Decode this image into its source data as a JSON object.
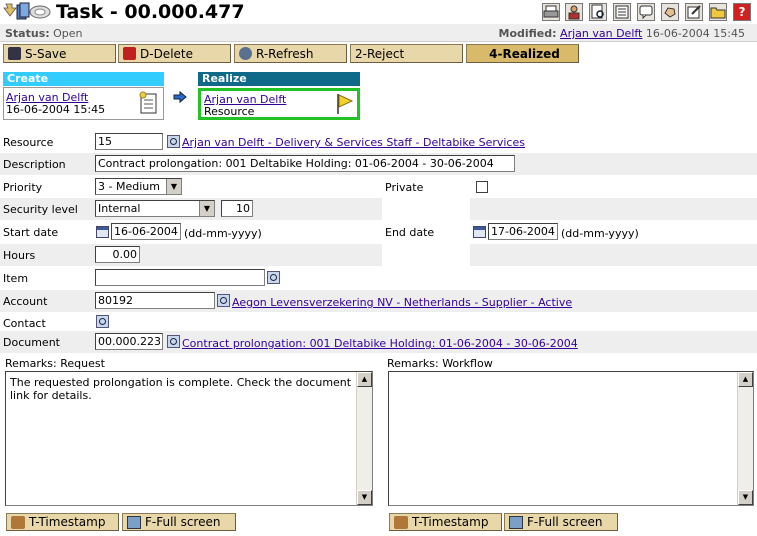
{
  "header": {
    "title": "Task - 00.000.477",
    "status_label": "Status:",
    "status_value": "Open",
    "modified_label": "Modified:",
    "modified_by": "Arjan van Delft",
    "modified_date": "16-06-2004 15:45",
    "help_label": "?"
  },
  "toolbar": {
    "save": "S-Save",
    "delete": "D-Delete",
    "refresh": "R-Refresh",
    "reject": "2-Reject",
    "realized": "4-Realized"
  },
  "workflow": {
    "create_title": "Create",
    "create_user": "Arjan van Delft",
    "create_date": "16-06-2004 15:45",
    "realize_title": "Realize",
    "realize_user": "Arjan van Delft",
    "realize_role": "Resource"
  },
  "form": {
    "resource": {
      "label": "Resource",
      "value": "15",
      "link": "Arjan van Delft - Delivery & Services Staff - Deltabike Services"
    },
    "description": {
      "label": "Description",
      "value": "Contract prolongation: 001 Deltabike Holding: 01-06-2004 - 30-06-2004"
    },
    "priority": {
      "label": "Priority",
      "value": "3 - Medium"
    },
    "private": {
      "label": "Private",
      "checked": false
    },
    "security": {
      "label": "Security level",
      "value": "Internal",
      "level": "10"
    },
    "start_date": {
      "label": "Start date",
      "value": "16-06-2004",
      "hint": "(dd-mm-yyyy)"
    },
    "end_date": {
      "label": "End date",
      "value": "17-06-2004",
      "hint": "(dd-mm-yyyy)"
    },
    "hours": {
      "label": "Hours",
      "value": "0.00"
    },
    "item": {
      "label": "Item",
      "value": ""
    },
    "account": {
      "label": "Account",
      "value": "80192",
      "link": "Aegon Levensverzekering NV - Netherlands - Supplier - Active"
    },
    "contact": {
      "label": "Contact"
    },
    "document": {
      "label": "Document",
      "value": "00.000.223",
      "link": "Contract prolongation: 001 Deltabike Holding: 01-06-2004 - 30-06-2004"
    }
  },
  "remarks": {
    "request_label": "Remarks: Request",
    "request_text": "The requested prolongation is complete. Check the document link for details.",
    "workflow_label": "Remarks: Workflow",
    "workflow_text": ""
  },
  "bottom": {
    "timestamp": "T-Timestamp",
    "fullscreen": "F-Full screen"
  },
  "colors": {
    "button_bg": "#e8d7a8",
    "create_header": "#33ccff",
    "realize_header": "#0f6a8a",
    "active_border": "#22c322",
    "link": "#330099"
  }
}
